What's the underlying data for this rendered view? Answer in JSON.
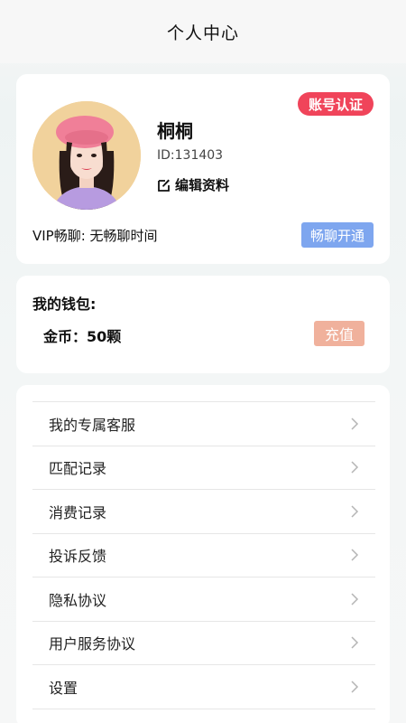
{
  "header": {
    "title": "个人中心"
  },
  "profile": {
    "name": "桐桐",
    "id_text": "ID:131403",
    "edit_label": "编辑资料",
    "verify_badge": "账号认证",
    "vip_text": "VIP畅聊: 无畅聊时间",
    "vip_button": "畅聊开通"
  },
  "wallet": {
    "title": "我的钱包:",
    "coins_text": "金币：50颗",
    "recharge_label": "充值"
  },
  "menu": {
    "items": [
      {
        "label": "我的专属客服"
      },
      {
        "label": "匹配记录"
      },
      {
        "label": "消费记录"
      },
      {
        "label": "投诉反馈"
      },
      {
        "label": "隐私协议"
      },
      {
        "label": "用户服务协议"
      },
      {
        "label": "设置"
      }
    ]
  },
  "colors": {
    "verify_badge": "#f0445a",
    "vip_button": "#7ea6ef",
    "recharge_button": "#f0b19c"
  }
}
